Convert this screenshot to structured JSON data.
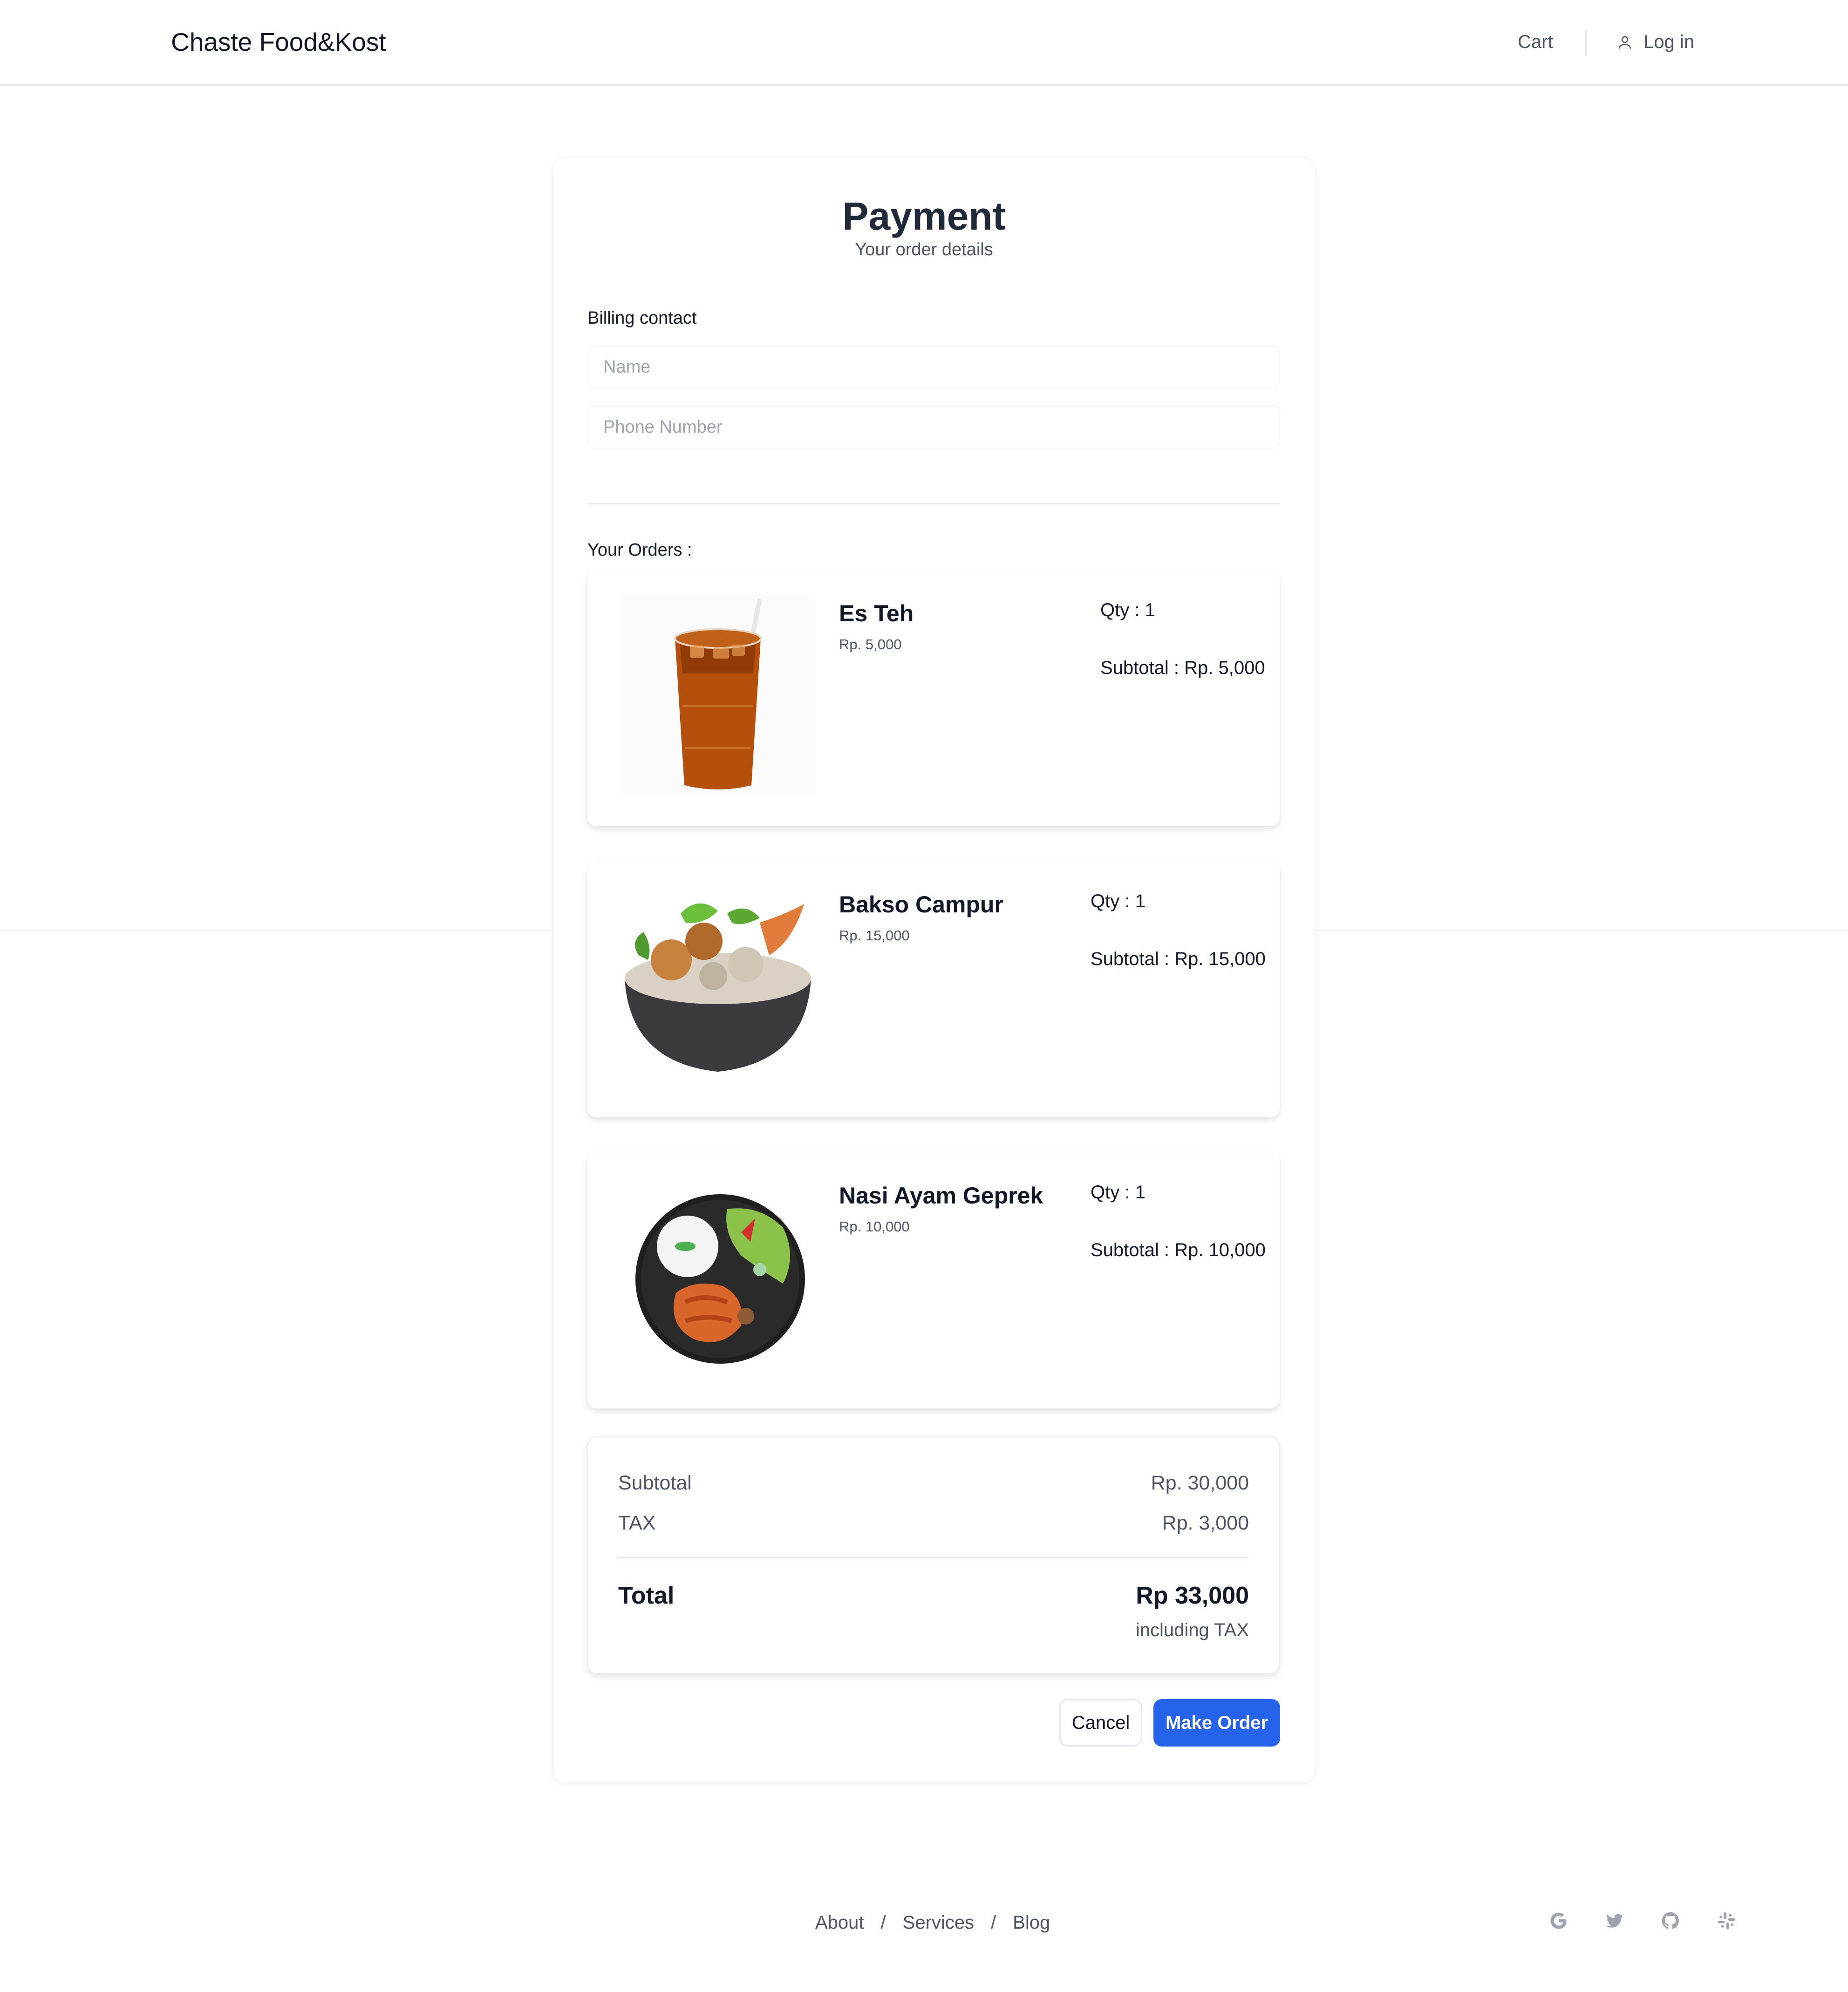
{
  "header": {
    "brand": "Chaste Food&Kost",
    "cart": "Cart",
    "login": "Log in"
  },
  "payment": {
    "title": "Payment",
    "subtitle": "Your order details",
    "billing_label": "Billing contact",
    "name_placeholder": "Name",
    "name_value": "",
    "phone_placeholder": "Phone Number",
    "phone_value": "",
    "orders_label": "Your Orders :"
  },
  "orders": [
    {
      "name": "Es Teh",
      "price": "Rp. 5,000",
      "qty": "Qty : 1",
      "subtotal": "Subtotal : Rp. 5,000",
      "icon": "iced-tea-image"
    },
    {
      "name": "Bakso Campur",
      "price": "Rp. 15,000",
      "qty": "Qty : 1",
      "subtotal": "Subtotal : Rp. 15,000",
      "icon": "bakso-bowl-image"
    },
    {
      "name": "Nasi Ayam Geprek",
      "price": "Rp. 10,000",
      "qty": "Qty : 1",
      "subtotal": "Subtotal : Rp. 10,000",
      "icon": "nasi-ayam-plate-image"
    }
  ],
  "summary": {
    "subtotal_label": "Subtotal",
    "subtotal_value": "Rp. 30,000",
    "tax_label": "TAX",
    "tax_value": "Rp. 3,000",
    "total_label": "Total",
    "total_value": "Rp 33,000",
    "total_note": "including TAX"
  },
  "actions": {
    "cancel": "Cancel",
    "make_order": "Make Order"
  },
  "footer": {
    "links": [
      "About",
      "Services",
      "Blog"
    ],
    "separator": "/",
    "social_icons": [
      "google-icon",
      "twitter-icon",
      "github-icon",
      "slack-icon"
    ]
  },
  "colors": {
    "primary": "#2563eb",
    "text": "#111827",
    "muted": "#4b5563",
    "border": "#e5e7eb"
  }
}
